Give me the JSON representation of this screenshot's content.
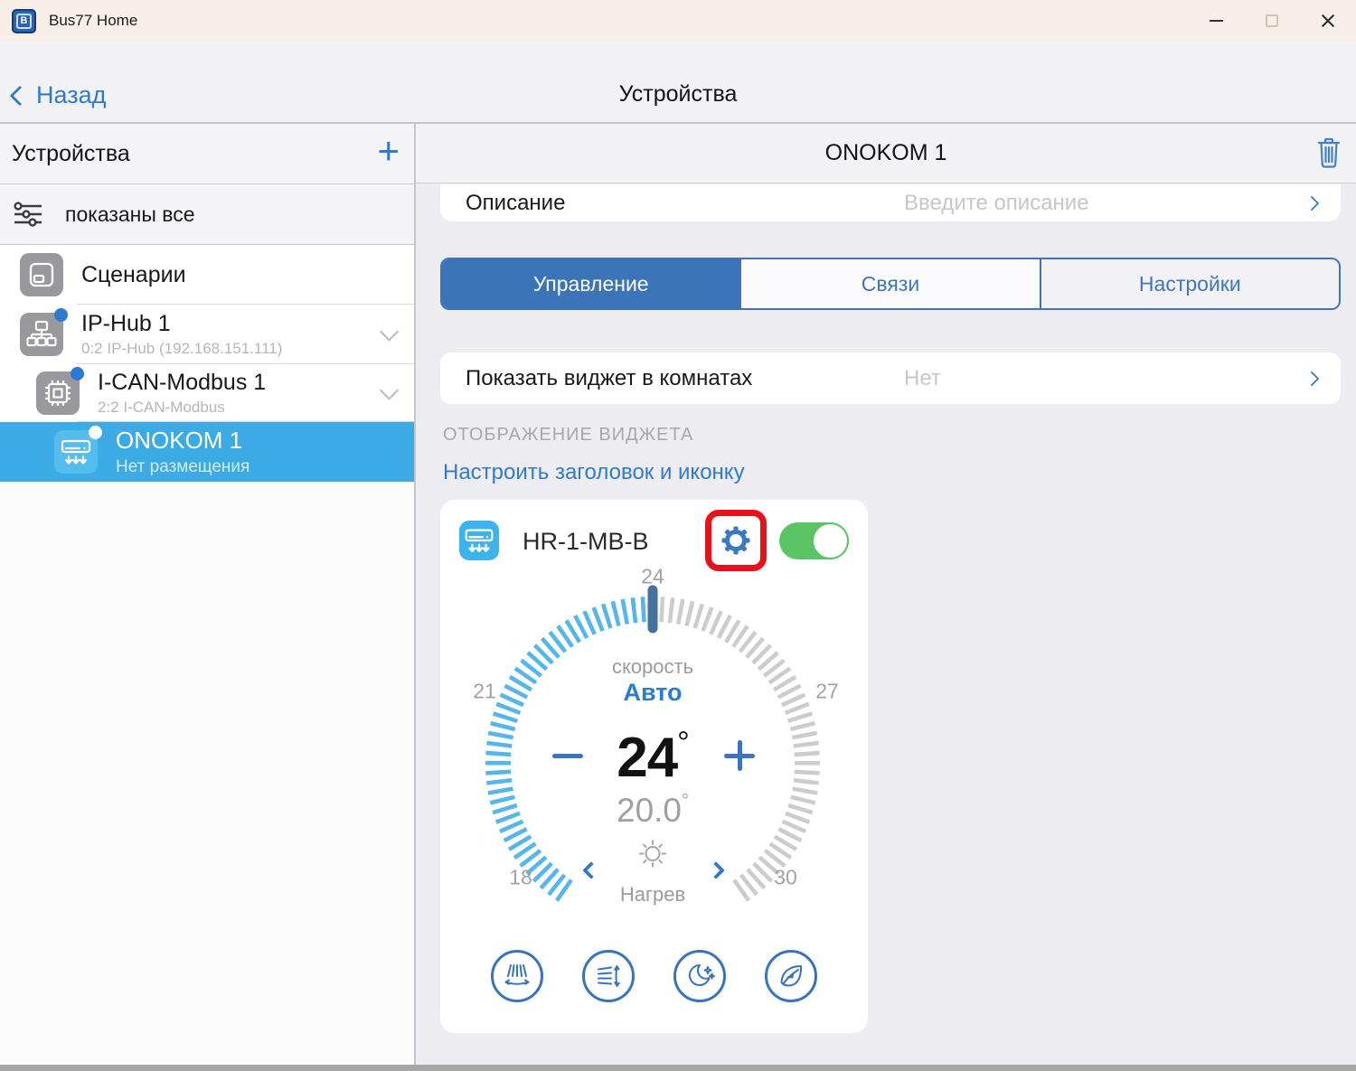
{
  "window": {
    "title": "Bus77 Home",
    "logo_letter": "B"
  },
  "nav": {
    "back": "Назад",
    "title": "Устройства"
  },
  "sidebar": {
    "title": "Устройства",
    "add": "+",
    "filter": "показаны все",
    "items": [
      {
        "label": "Сценарии"
      },
      {
        "label": "IP-Hub 1",
        "subtitle": "0:2 IP-Hub (192.168.151.111)"
      },
      {
        "label": "I-CAN-Modbus 1",
        "subtitle": "2:2 I-CAN-Modbus"
      },
      {
        "label": "ONOKOM 1",
        "subtitle": "Нет размещения"
      }
    ]
  },
  "detail": {
    "title": "ONOKOM 1",
    "description": {
      "label": "Описание",
      "placeholder": "Введите описание"
    },
    "tabs": [
      {
        "label": "Управление"
      },
      {
        "label": "Связи"
      },
      {
        "label": "Настройки"
      }
    ],
    "active_tab": "Управление",
    "rooms_row": {
      "label": "Показать виджет в комнатах",
      "value": "Нет"
    },
    "section": "ОТОБРАЖЕНИЕ ВИДЖЕТА",
    "configure_link": "Настроить заголовок и иконку",
    "widget": {
      "title": "HR-1-MB-B",
      "power_on": true,
      "speed_label": "скорость",
      "speed_value": "Авто",
      "setpoint": "24",
      "degree": "°",
      "ambient": "20.0",
      "mode": "Нагрев",
      "gauge": {
        "min": 18,
        "max": 30,
        "value": 24,
        "ambient": 20.0,
        "tick_labels": [
          "18",
          "21",
          "24",
          "27",
          "30"
        ],
        "start_angle": -145,
        "end_angle": 145,
        "tick_count": 85,
        "active_color": "#55b6ea",
        "inactive_color": "#cccccc",
        "indicator_color": "#44719e"
      }
    }
  },
  "colors": {
    "accent": "#2e7ad0",
    "tab_active": "#3b74b8",
    "selected_item": "#3caae4",
    "toggle_on": "#5bc464",
    "highlight_red": "#e8111b"
  }
}
